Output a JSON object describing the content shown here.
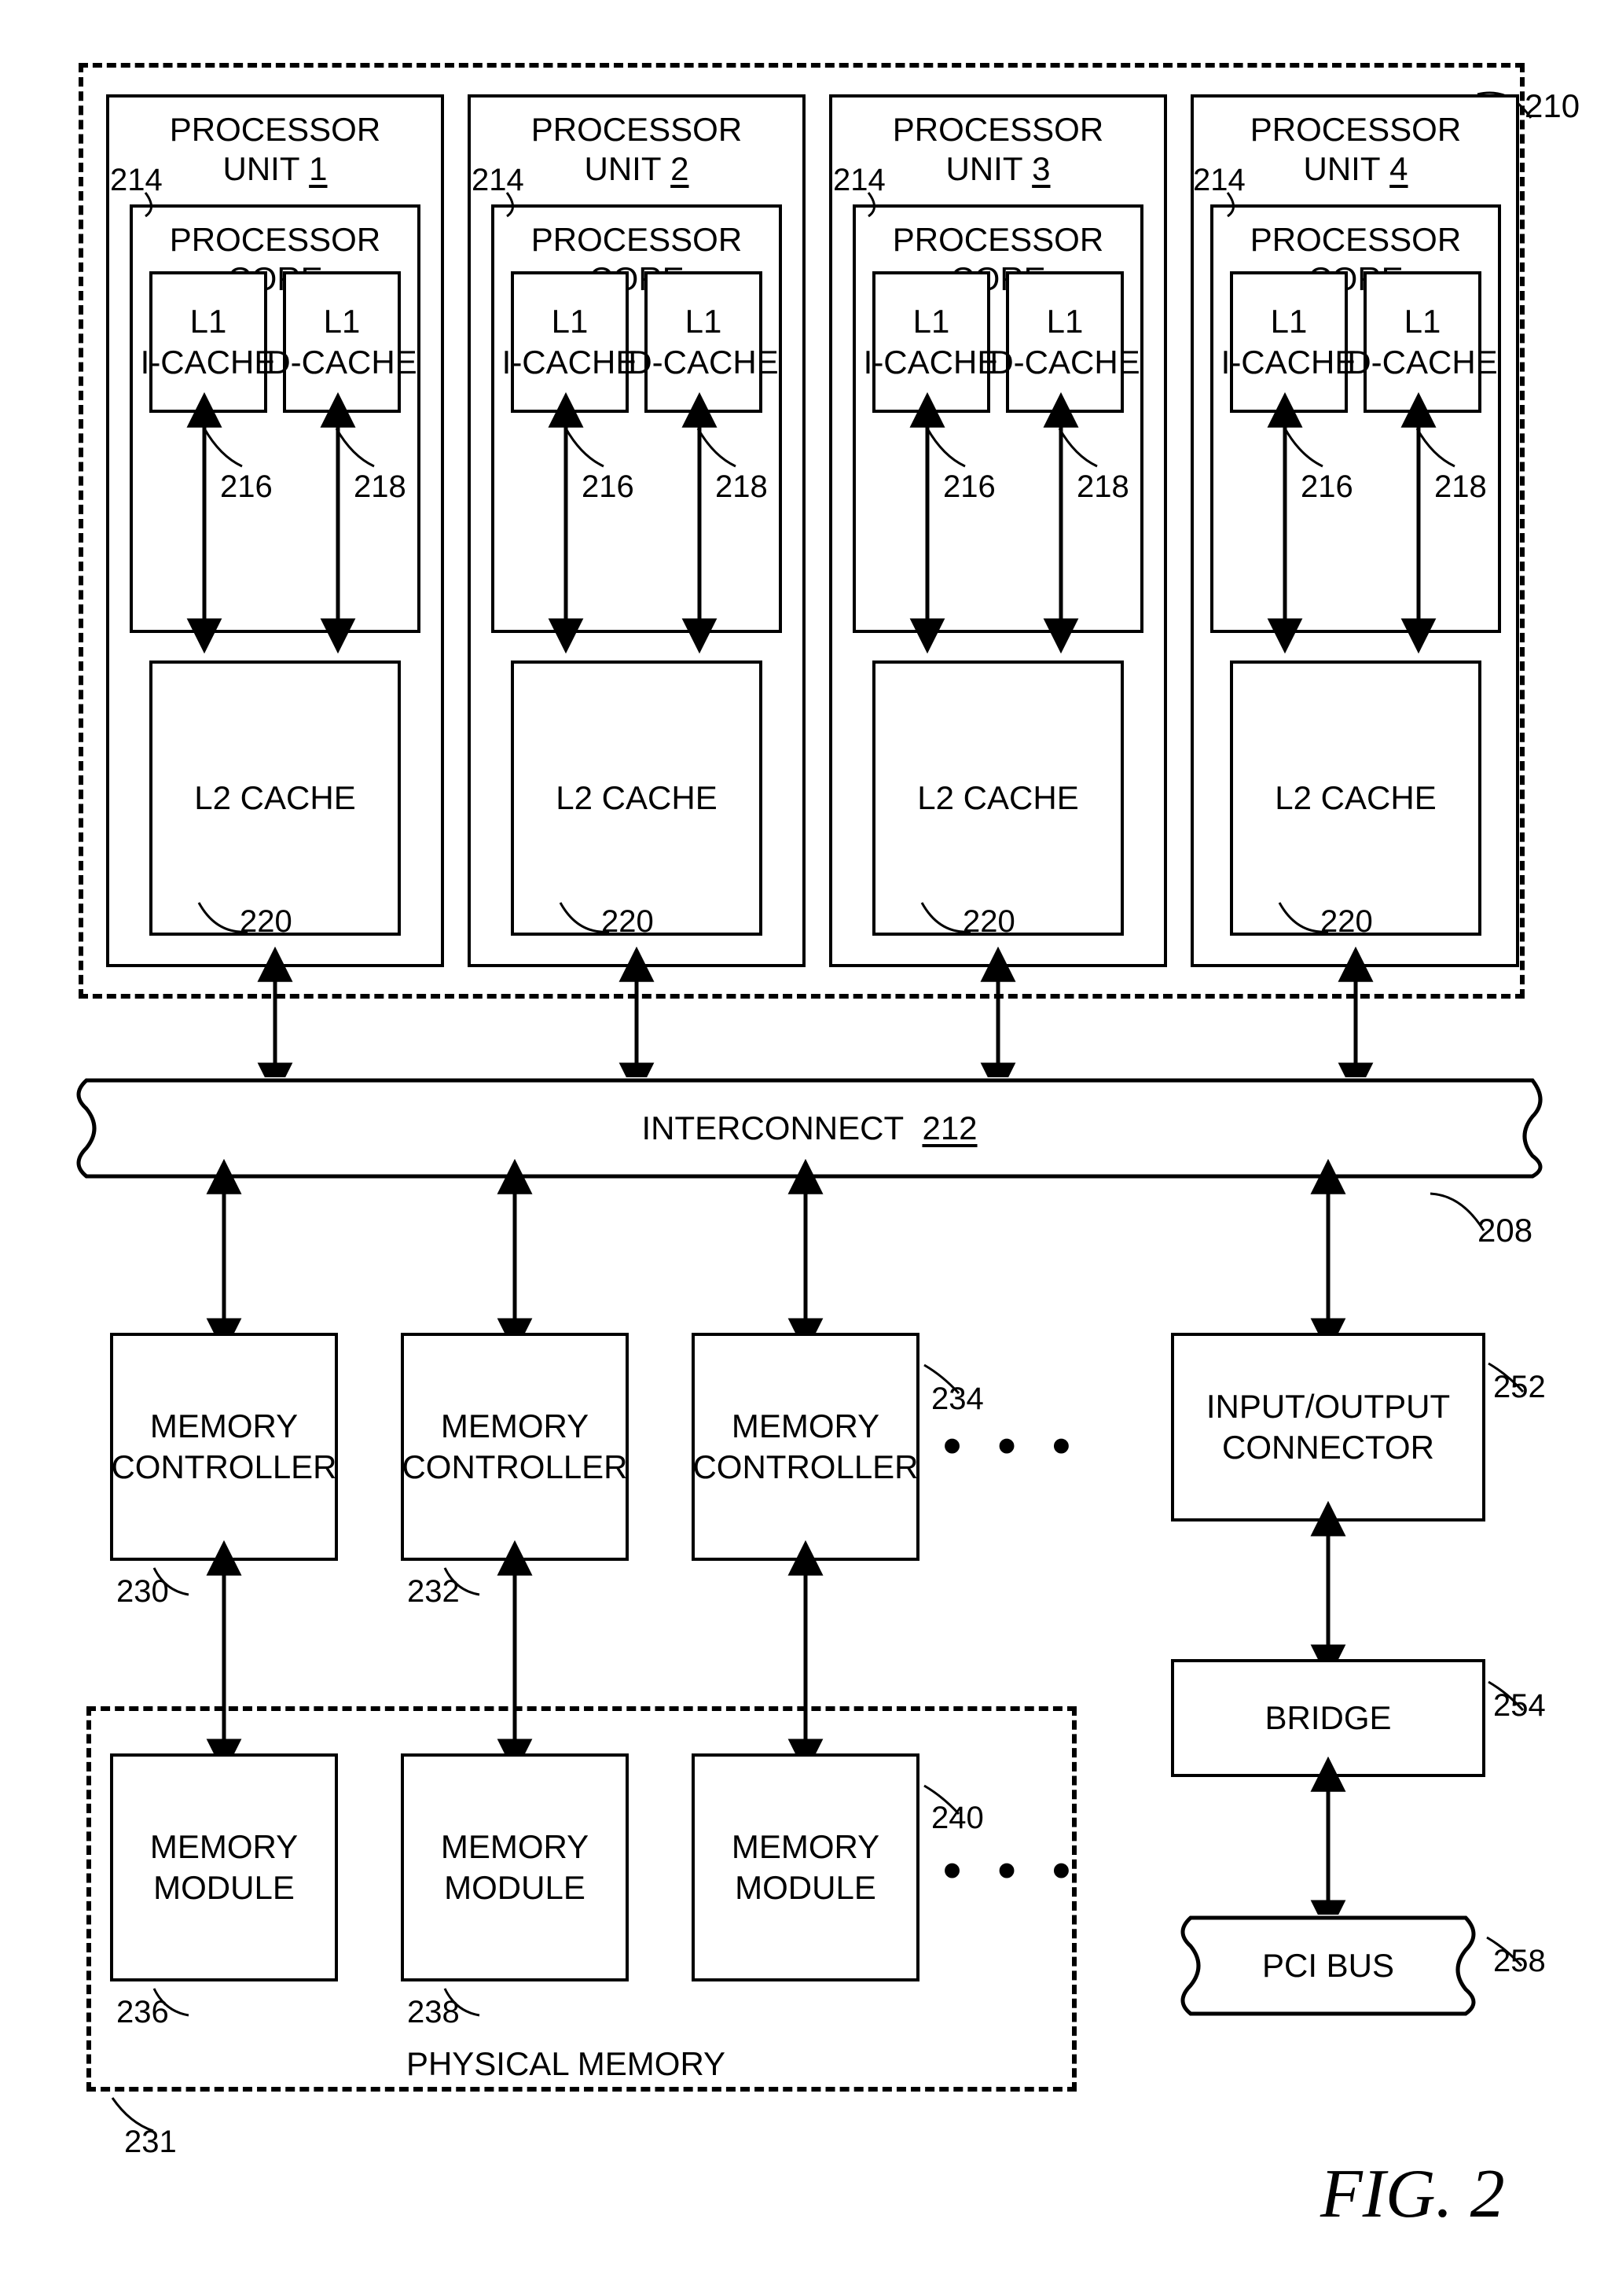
{
  "figure_label": "FIG. 2",
  "refs": {
    "processor_package": "210",
    "system": "208",
    "core": "214",
    "icache": "216",
    "dcache": "218",
    "l2": "220",
    "interconnect": "212",
    "memctrl0": "230",
    "memctrl1": "232",
    "memctrl2": "234",
    "memmod0": "236",
    "memmod1": "238",
    "memmod2": "240",
    "physmem": "231",
    "ioconn": "252",
    "bridge": "254",
    "pcibus": "258"
  },
  "blocks": {
    "proc_unit_prefix": "PROCESSOR UNIT",
    "proc_unit_nums": [
      "1",
      "2",
      "3",
      "4"
    ],
    "core": "PROCESSOR CORE",
    "icache": "L1\nI-CACHE",
    "dcache": "L1\nD-CACHE",
    "l2": "L2 CACHE",
    "interconnect": "INTERCONNECT",
    "memctrl": "MEMORY\nCONTROLLER",
    "memmod": "MEMORY\nMODULE",
    "ioconn": "INPUT/OUTPUT\nCONNECTOR",
    "bridge": "BRIDGE",
    "pcibus": "PCI BUS",
    "physmem": "PHYSICAL MEMORY"
  }
}
